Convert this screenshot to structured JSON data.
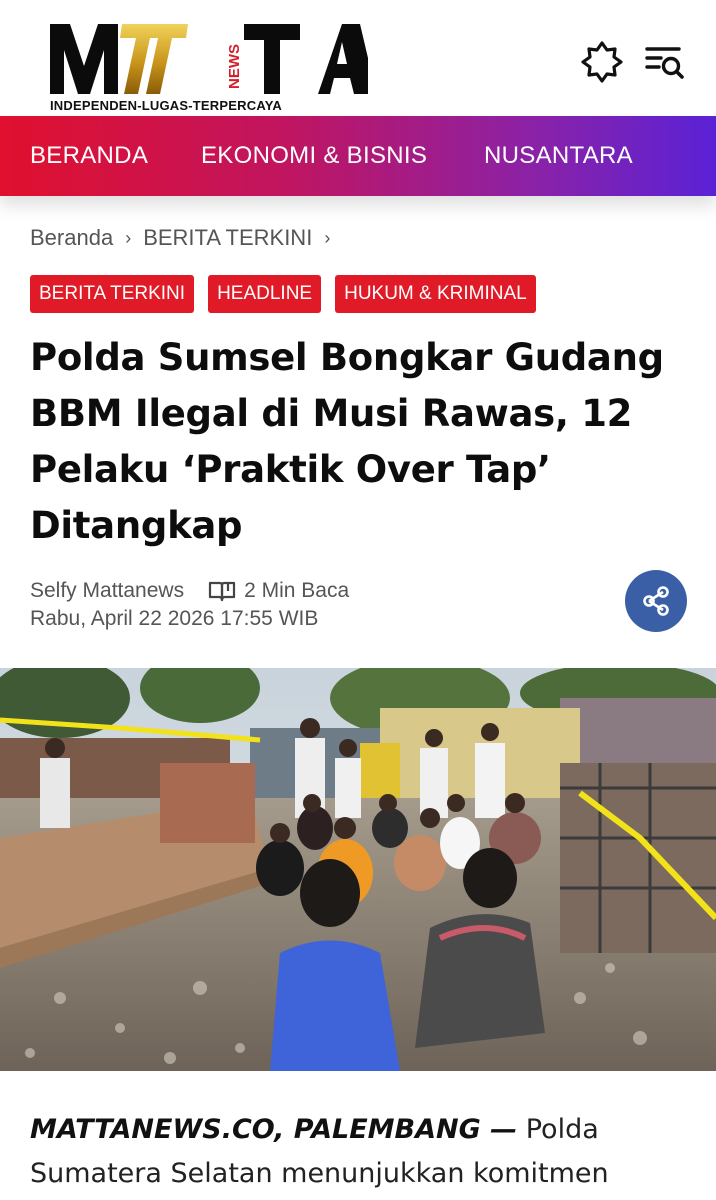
{
  "site": {
    "logo_text": "MATTA NEWS",
    "logo_news": "NEWS",
    "tagline": "INDEPENDEN-LUGAS-TERPERCAYA"
  },
  "header": {
    "theme_icon": "sun-moon-icon",
    "search_icon": "menu-search-icon"
  },
  "nav": {
    "items": [
      {
        "label": "BERANDA"
      },
      {
        "label": "EKONOMI & BISNIS"
      },
      {
        "label": "NUSANTARA"
      }
    ],
    "gradient": [
      "#e0102e",
      "#c01560",
      "#8a22a8",
      "#5a22d6"
    ]
  },
  "breadcrumb": {
    "items": [
      {
        "label": "Beranda"
      },
      {
        "label": "BERITA TERKINI"
      }
    ],
    "separator": "›"
  },
  "tags": [
    {
      "label": "BERITA TERKINI"
    },
    {
      "label": "HEADLINE"
    },
    {
      "label": "HUKUM & KRIMINAL"
    }
  ],
  "article": {
    "title": "Polda Sumsel Bongkar Gudang BBM Ilegal di Musi Rawas, 12 Pelaku ‘Praktik Over Tap’ Ditangkap",
    "author": "Selfy Mattanews",
    "read_time": "2 Min Baca",
    "datetime": "Rabu, April 22 2026 17:55 WIB",
    "dateline": "MATTANEWS.CO, PALEMBANG —",
    "lead": " Polda Sumatera Selatan menunjukkan komitmen"
  },
  "colors": {
    "tag_red": "#e11a28",
    "share_blue": "#3a5fa6",
    "logo_gold": "#c28f16"
  }
}
